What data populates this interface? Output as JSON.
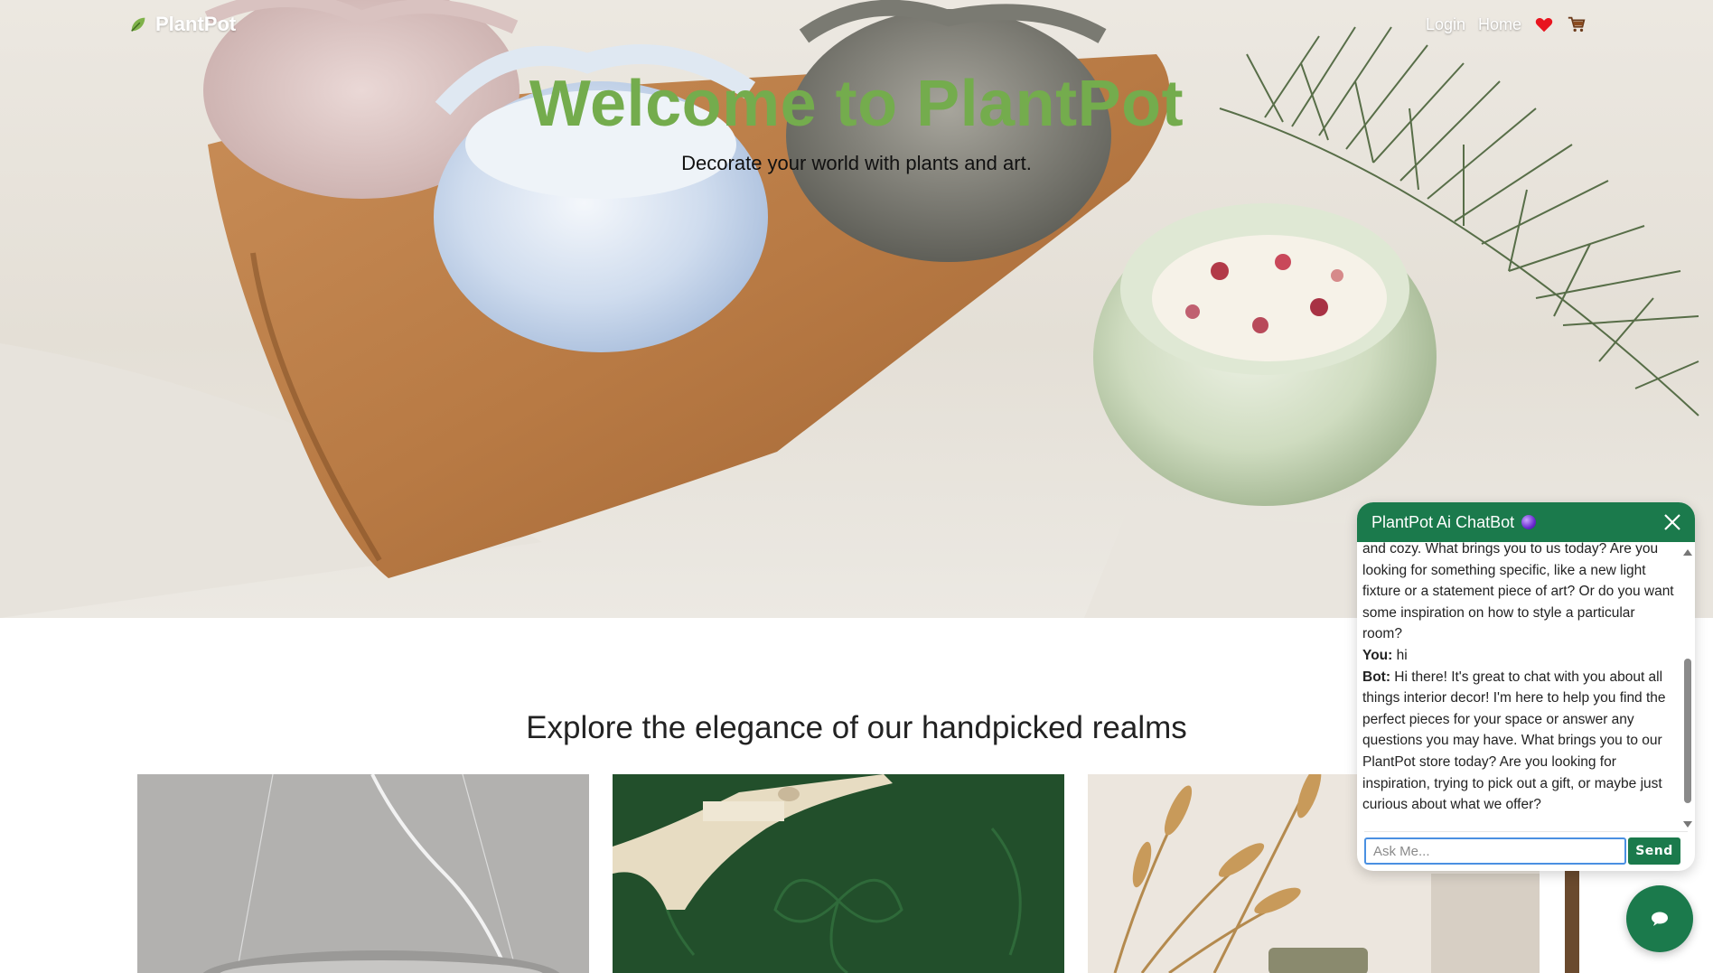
{
  "nav": {
    "brand": "PlantPot",
    "links": [
      {
        "label": "Login"
      },
      {
        "label": "Home"
      }
    ],
    "icons": [
      "heart-icon",
      "cart-icon"
    ]
  },
  "hero": {
    "title": "Welcome to PlantPot",
    "subtitle": "Decorate your world with plants and art."
  },
  "section": {
    "heading": "Explore the elegance of our handpicked realms"
  },
  "chatbot": {
    "title": "PlantPot Ai ChatBot",
    "messages": [
      {
        "speaker": "",
        "text": "and cozy. What brings you to us today? Are you looking for something specific, like a new light fixture or a statement piece of art? Or do you want some inspiration on how to style a particular room?"
      },
      {
        "speaker": "You:",
        "text": " hi"
      },
      {
        "speaker": "Bot:",
        "text": " Hi there! It's great to chat with you about all things interior decor! I'm here to help you find the perfect pieces for your space or answer any questions you may have. What brings you to our PlantPot store today? Are you looking for inspiration, trying to pick out a gift, or maybe just curious about what we offer?"
      }
    ],
    "input_placeholder": "Ask Me...",
    "send_label": "Send"
  },
  "colors": {
    "accent_green": "#1b7a4c",
    "title_green": "#74ac4d",
    "heart_red": "#e8141e"
  }
}
